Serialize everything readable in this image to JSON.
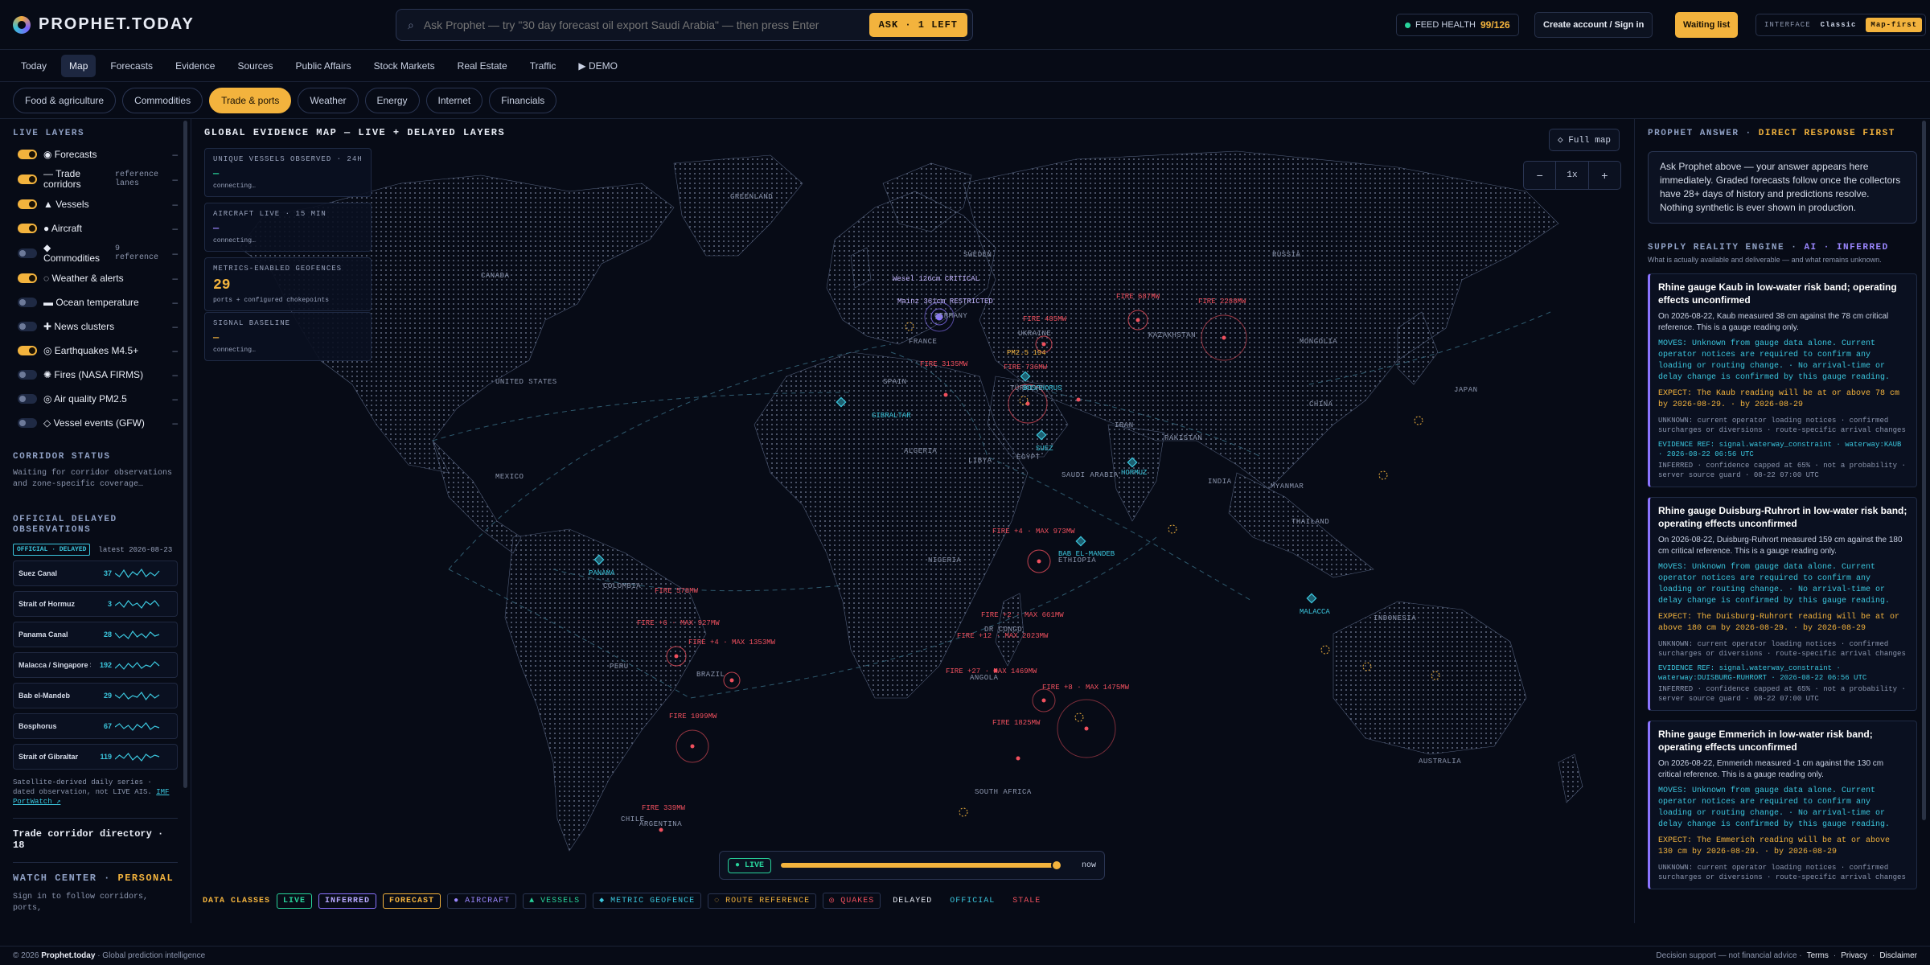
{
  "brand": {
    "name": "PROPHET.TODAY"
  },
  "search": {
    "placeholder": "Ask Prophet — try \"30 day forecast oil export Saudi Arabia\" — then press Enter",
    "ask_label": "ASK · 1 LEFT"
  },
  "header": {
    "feed_label": "FEED HEALTH",
    "feed_value": "99/126",
    "account_label": "Create account / Sign in",
    "waiting_label": "Waiting list",
    "interface_label": "INTERFACE",
    "interface_options": [
      "Classic",
      "Map-first"
    ],
    "interface_selected": "Map-first"
  },
  "nav": {
    "items": [
      "Today",
      "Map",
      "Forecasts",
      "Evidence",
      "Sources",
      "Public Affairs",
      "Stock Markets",
      "Real Estate",
      "Traffic",
      "▶ DEMO"
    ],
    "active": "Map"
  },
  "categories": {
    "items": [
      "Food & agriculture",
      "Commodities",
      "Trade & ports",
      "Weather",
      "Energy",
      "Internet",
      "Financials"
    ],
    "active": "Trade & ports"
  },
  "left": {
    "live_layers_title": "LIVE LAYERS",
    "layers": [
      {
        "label": "◉ Forecasts",
        "note": "",
        "on": true,
        "value": "–"
      },
      {
        "label": "— Trade corridors",
        "note": "reference lanes",
        "on": true,
        "value": "–"
      },
      {
        "label": "▲ Vessels",
        "note": "",
        "on": true,
        "value": "–"
      },
      {
        "label": "● Aircraft",
        "note": "",
        "on": true,
        "value": "–"
      },
      {
        "label": "◆ Commodities",
        "note": "9 reference",
        "on": false,
        "value": "–"
      },
      {
        "label": "◌ Weather & alerts",
        "note": "",
        "on": true,
        "value": "–"
      },
      {
        "label": "▬ Ocean temperature",
        "note": "",
        "on": false,
        "value": "–"
      },
      {
        "label": "✚ News clusters",
        "note": "",
        "on": false,
        "value": "–"
      },
      {
        "label": "◎ Earthquakes M4.5+",
        "note": "",
        "on": true,
        "value": "–"
      },
      {
        "label": "✺ Fires (NASA FIRMS)",
        "note": "",
        "on": false,
        "value": "–"
      },
      {
        "label": "◎ Air quality PM2.5",
        "note": "",
        "on": false,
        "value": "–"
      },
      {
        "label": "◇ Vessel events (GFW)",
        "note": "",
        "on": false,
        "value": "–"
      }
    ],
    "corridor_status_title": "CORRIDOR STATUS",
    "corridor_status_text": "Waiting for corridor observations and zone-specific coverage…",
    "official_title": "OFFICIAL DELAYED OBSERVATIONS",
    "official_badge": "OFFICIAL · DELAYED",
    "latest_label": "latest 2026-08-23",
    "observations": [
      {
        "name": "Suez Canal",
        "value": "37"
      },
      {
        "name": "Strait of Hormuz",
        "value": "3"
      },
      {
        "name": "Panama Canal",
        "value": "28"
      },
      {
        "name": "Malacca / Singapore S…",
        "value": "192"
      },
      {
        "name": "Bab el-Mandeb",
        "value": "29"
      },
      {
        "name": "Bosphorus",
        "value": "67"
      },
      {
        "name": "Strait of Gibraltar",
        "value": "119"
      }
    ],
    "satellite_note": "Satellite-derived daily series · dated observation, not LIVE AIS.",
    "satellite_link": "IMF PortWatch ↗",
    "directory_title": "Trade corridor directory · 18",
    "watch_title": "WATCH CENTER ·",
    "watch_accent": "PERSONAL",
    "watch_text": "Sign in to follow corridors, ports,"
  },
  "map": {
    "title": "GLOBAL EVIDENCE MAP — LIVE + DELAYED LAYERS",
    "full_map_label": "◇ Full map",
    "zoom_level": "1x",
    "stats": [
      {
        "label": "UNIQUE VESSELS OBSERVED · 24H",
        "value": "—",
        "sub": "connecting…"
      },
      {
        "label": "AIRCRAFT LIVE · 15 MIN",
        "value": "—",
        "sub": "connecting…"
      },
      {
        "label": "METRICS-ENABLED GEOFENCES",
        "value": "29",
        "sub": "ports + configured chokepoints"
      },
      {
        "label": "SIGNAL BASELINE",
        "value": "—",
        "sub": "connecting…"
      }
    ],
    "region_labels": [
      "GREENLAND",
      "CANADA",
      "UNITED STATES",
      "MEXICO",
      "COLOMBIA",
      "PERU",
      "BRAZIL",
      "CHILE",
      "ARGENTINA",
      "SWEDEN",
      "RUSSIA",
      "GERMANY",
      "FRANCE",
      "SPAIN",
      "UKRAINE",
      "TÜRKIYE",
      "KAZAKHSTAN",
      "MONGOLIA",
      "CHINA",
      "JAPAN",
      "IRAN",
      "PAKISTAN",
      "INDIA",
      "MYANMAR",
      "THAILAND",
      "INDONESIA",
      "AUSTRALIA",
      "ALGERIA",
      "LIBYA",
      "EGYPT",
      "SAUDI ARABIA",
      "NIGERIA",
      "ETHIOPIA",
      "DR CONGO",
      "ANGOLA",
      "SOUTH AFRICA"
    ],
    "chokepoints": [
      "GIBRALTAR",
      "SUEZ",
      "BOSPHORUS",
      "HORMUZ",
      "BAB EL-MANDEB",
      "PANAMA",
      "MALACCA"
    ],
    "fire_labels": [
      "FIRE 687MW",
      "FIRE 2288MW",
      "FIRE 485MW",
      "FIRE 3135MW",
      "FIRE 736MW",
      "FIRE +4 · MAX 973MW",
      "FIRE +2 · MAX 661MW",
      "FIRE +12 · MAX 2023MW",
      "FIRE +27 · MAX 1469MW",
      "FIRE +8 · MAX 1475MW",
      "FIRE 1825MW",
      "FIRE 578MW",
      "FIRE +6 · MAX 927MW",
      "FIRE +4 · MAX 1353MW",
      "FIRE 1099MW",
      "FIRE 339MW"
    ],
    "vessel_labels": [
      "Wesel 126cm CRITICAL",
      "Mainz 361cm RESTRICTED"
    ],
    "pm_label": "PM2.5 194",
    "timeline_live": "● LIVE",
    "timeline_now": "now",
    "timeline_position": 0.98,
    "data_classes_label": "DATA CLASSES",
    "data_classes": [
      "LIVE",
      "INFERRED",
      "FORECAST",
      "● AIRCRAFT",
      "▲ VESSELS",
      "◆ METRIC GEOFENCE",
      "◌ ROUTE REFERENCE",
      "◎ QUAKES",
      "DELAYED",
      "OFFICIAL",
      "STALE"
    ]
  },
  "right": {
    "answer_title": "PROPHET ANSWER ·",
    "answer_accent": "DIRECT RESPONSE FIRST",
    "answer_text": "Ask Prophet above — your answer appears here immediately. Graded forecasts follow once the collectors have 28+ days of history and predictions resolve. Nothing synthetic is ever shown in production.",
    "engine_title": "SUPPLY REALITY ENGINE ·",
    "engine_accent": "AI · INFERRED",
    "engine_sub": "What is actually available and deliverable — and what remains unknown.",
    "cards": [
      {
        "title": "Rhine gauge Kaub in low-water risk band; operating effects unconfirmed",
        "body": "On 2026-08-22, Kaub measured 38 cm against the 78 cm critical reference. This is a gauge reading only.",
        "moves": "MOVES: Unknown from gauge data alone. Current operator notices are required to confirm any loading or routing change. · No arrival-time or delay change is confirmed by this gauge reading.",
        "expect": "EXPECT: The Kaub reading will be at or above 78 cm by 2026-08-29. · by 2026-08-29",
        "unknown": "UNKNOWN: current operator loading notices · confirmed surcharges or diversions · route-specific arrival changes",
        "ref": "EVIDENCE REF: signal.waterway_constraint · waterway:KAUB · 2026-08-22 06:56 UTC",
        "inferred": "INFERRED · confidence capped at 65% · not a probability · server source guard · 08-22 07:00 UTC"
      },
      {
        "title": "Rhine gauge Duisburg-Ruhrort in low-water risk band; operating effects unconfirmed",
        "body": "On 2026-08-22, Duisburg-Ruhrort measured 159 cm against the 180 cm critical reference. This is a gauge reading only.",
        "moves": "MOVES: Unknown from gauge data alone. Current operator notices are required to confirm any loading or routing change. · No arrival-time or delay change is confirmed by this gauge reading.",
        "expect": "EXPECT: The Duisburg-Ruhrort reading will be at or above 180 cm by 2026-08-29. · by 2026-08-29",
        "unknown": "UNKNOWN: current operator loading notices · confirmed surcharges or diversions · route-specific arrival changes",
        "ref": "EVIDENCE REF: signal.waterway_constraint · waterway:DUISBURG-RUHRORT · 2026-08-22 06:56 UTC",
        "inferred": "INFERRED · confidence capped at 65% · not a probability · server source guard · 08-22 07:00 UTC"
      },
      {
        "title": "Rhine gauge Emmerich in low-water risk band; operating effects unconfirmed",
        "body": "On 2026-08-22, Emmerich measured -1 cm against the 130 cm critical reference. This is a gauge reading only.",
        "moves": "MOVES: Unknown from gauge data alone. Current operator notices are required to confirm any loading or routing change. · No arrival-time or delay change is confirmed by this gauge reading.",
        "expect": "EXPECT: The Emmerich reading will be at or above 130 cm by 2026-08-29. · by 2026-08-29",
        "unknown": "UNKNOWN: current operator loading notices · confirmed surcharges or diversions · route-specific arrival changes",
        "ref": "",
        "inferred": ""
      }
    ]
  },
  "footer": {
    "copyright": "© 2026",
    "brand": "Prophet.today",
    "tagline": "· Global prediction intelligence",
    "decision": "Decision support — not financial advice ·",
    "links": [
      "Terms",
      "Privacy",
      "Disclaimer"
    ]
  },
  "colors": {
    "accent": "#f3b33d",
    "cyan": "#3bc6dd",
    "purple": "#8b74ff",
    "fire": "#f0505e",
    "live": "#28d39b"
  }
}
